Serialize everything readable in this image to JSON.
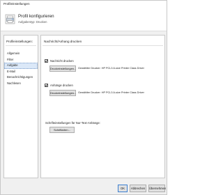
{
  "window": {
    "title": "Profileinstellungen"
  },
  "header": {
    "title": "Profil konfigurieren",
    "subtitle": "Aufgabentyp: Drucken",
    "icon": "printer-profile-icon"
  },
  "left_panel": {
    "heading": "Profileinstellungen:",
    "items": [
      {
        "label": "Allgemein"
      },
      {
        "label": "Filter"
      },
      {
        "label": "Aufgabe",
        "selected": true
      },
      {
        "label": "E-Mail"
      },
      {
        "label": "Benachrichtigungen"
      },
      {
        "label": "Nachlesen"
      }
    ]
  },
  "right_panel": {
    "heading": "Nachricht/Anhang drucken",
    "print_message": {
      "checkbox_label": "Nachricht drucken",
      "checked": true,
      "button_label": "Druckeinstellungen...",
      "printer_info": "Gewählter Drucker: HP PCL3 A-size Printer Class Driver"
    },
    "print_attachments": {
      "checkbox_label": "Anhänge drucken",
      "checked": true,
      "button_label": "Druckeinstellungen...",
      "printer_info": "Gewählter Drucker: HP PCL3 A-size Printer Class Driver"
    },
    "font_settings": {
      "label": "Schrifteinstellungen für Nur-Text-Anhänge:",
      "button_label": "Schriftarten..."
    }
  },
  "footer": {
    "ok_label": "OK",
    "cancel_label": "Abbrechen",
    "help_label": "Übernehmen"
  },
  "colors": {
    "accent": "#3c7fd1",
    "selection": "#dbe8f8"
  }
}
